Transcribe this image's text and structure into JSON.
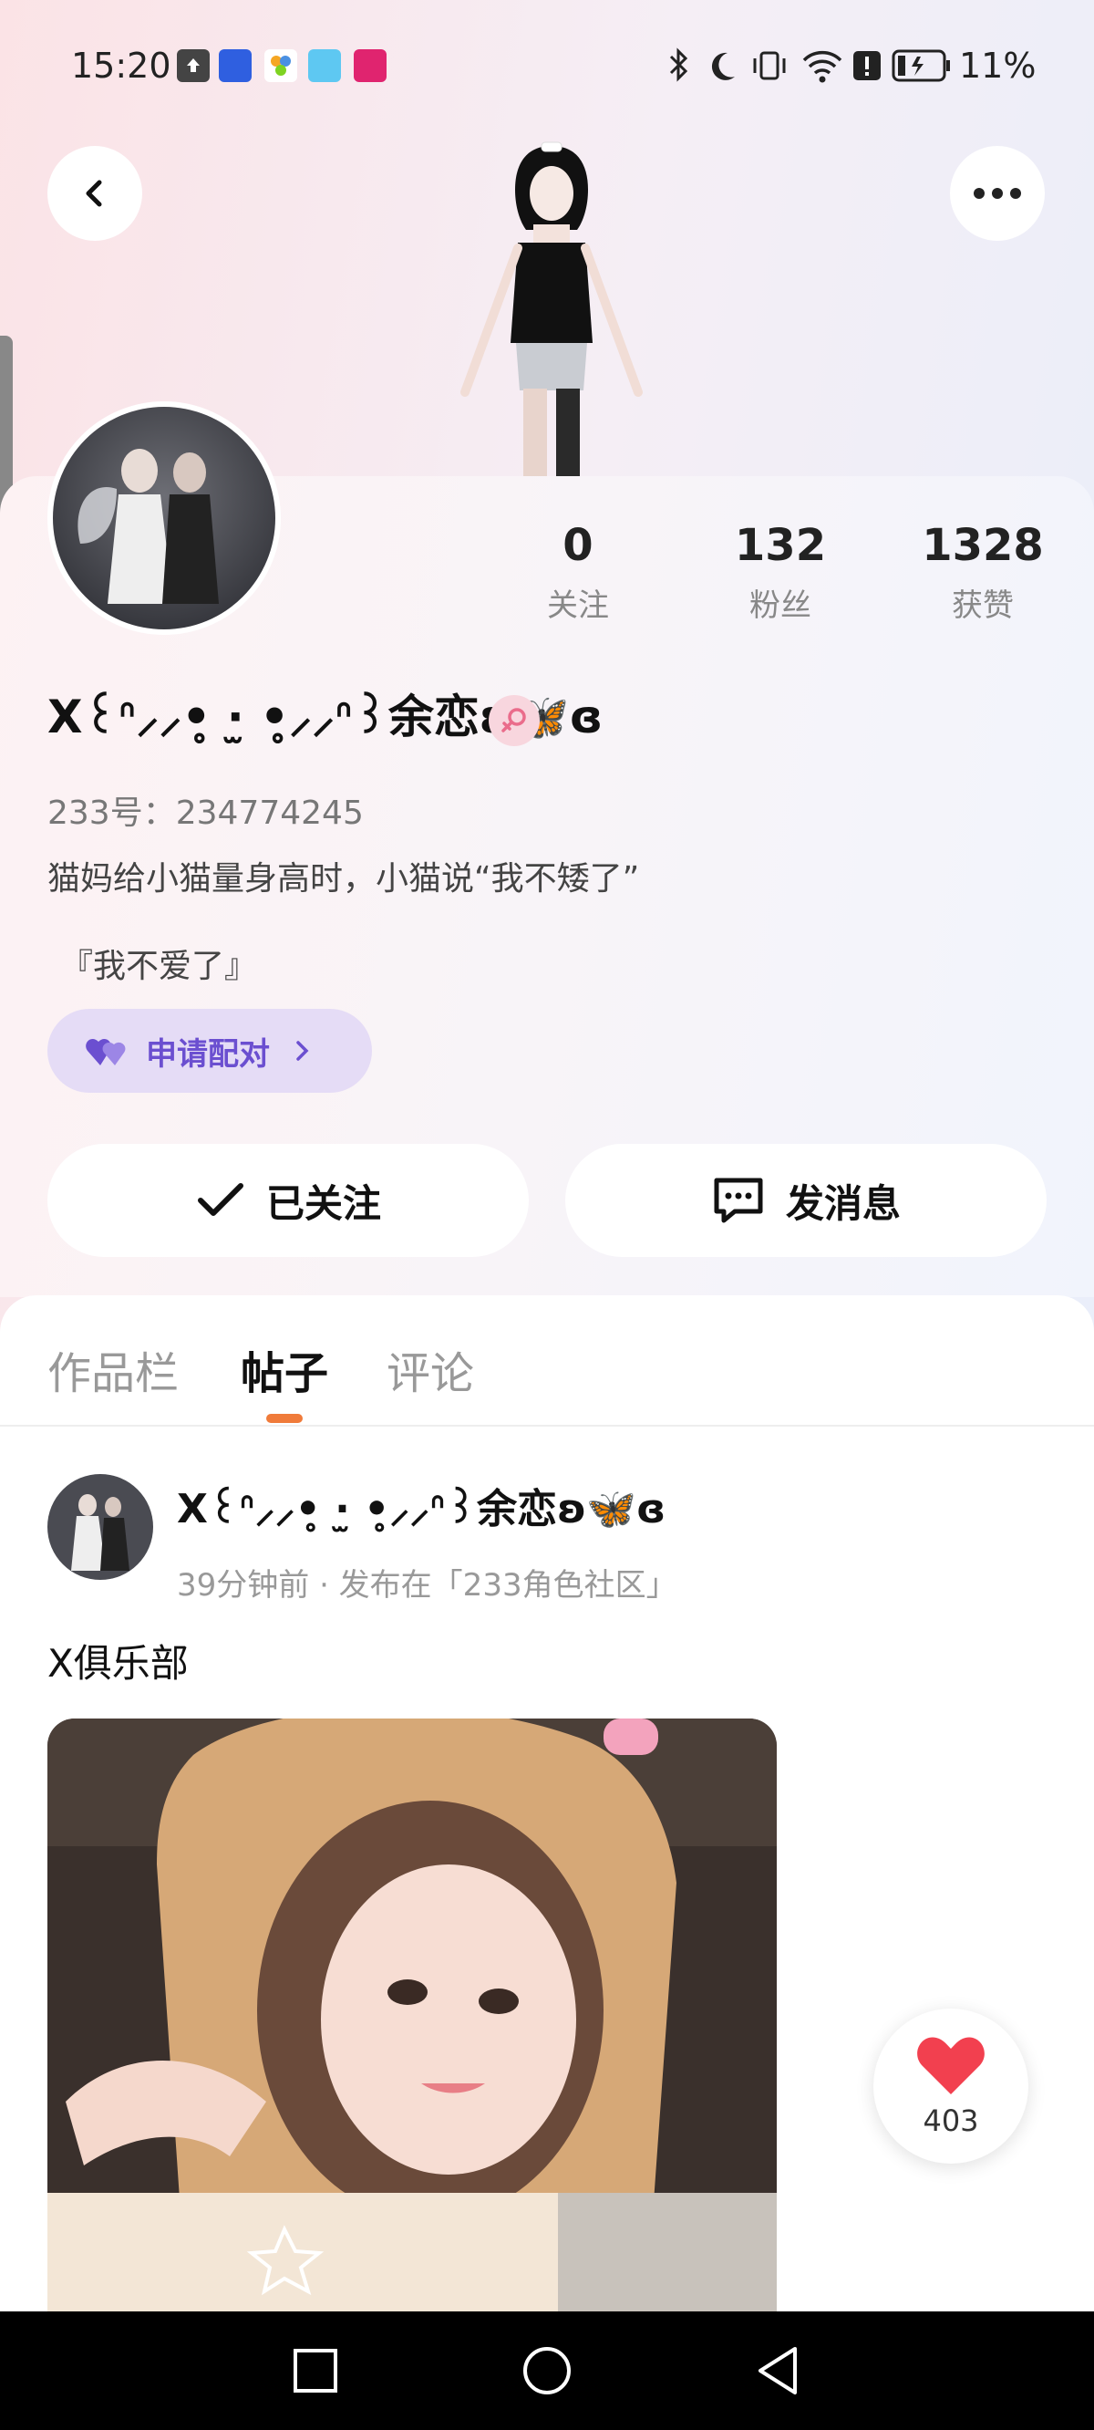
{
  "status_bar": {
    "time": "15:20",
    "battery_text": "11%",
    "icons": [
      "upload-icon",
      "honor-app-icon",
      "pinwheel-app-icon",
      "book-app-icon",
      "vip-app-icon",
      "bluetooth-icon",
      "moon-icon",
      "vibrate-icon",
      "wifi-icon",
      "alert-icon",
      "battery-icon"
    ]
  },
  "header": {
    "back_icon": "chevron-left-icon",
    "more_icon": "more-dots-icon"
  },
  "profile": {
    "nickname": "X꒰ᐢ⸝⸝•̥ ·̫ •̥⸝⸝ᐢ꒱余恋ʚ🦋ɞ",
    "id_text": "233号：234774245",
    "bio_line1": "猫妈给小猫量身高时，小猫说“我不矮了”",
    "bio_line2": "『我不爱了』",
    "pair_label": "申请配对",
    "stats": [
      {
        "value": "0",
        "label": "关注"
      },
      {
        "value": "132",
        "label": "粉丝"
      },
      {
        "value": "1328",
        "label": "获赞"
      }
    ]
  },
  "actions": {
    "followed_label": "已关注",
    "message_label": "发消息"
  },
  "tabs": [
    {
      "label": "作品栏"
    },
    {
      "label": "帖子"
    },
    {
      "label": "评论"
    }
  ],
  "post": {
    "author": "X꒰ᐢ⸝⸝•̥ ·̫ •̥⸝⸝ᐢ꒱余恋ʚ🦋ɞ",
    "meta": "39分钟前 · 发布在「233角色社区」",
    "text": "X俱乐部"
  },
  "like": {
    "count": "403"
  },
  "colors": {
    "accent": "#f07b3a",
    "pair": "#6b4fd0",
    "heart": "#f2404f"
  }
}
